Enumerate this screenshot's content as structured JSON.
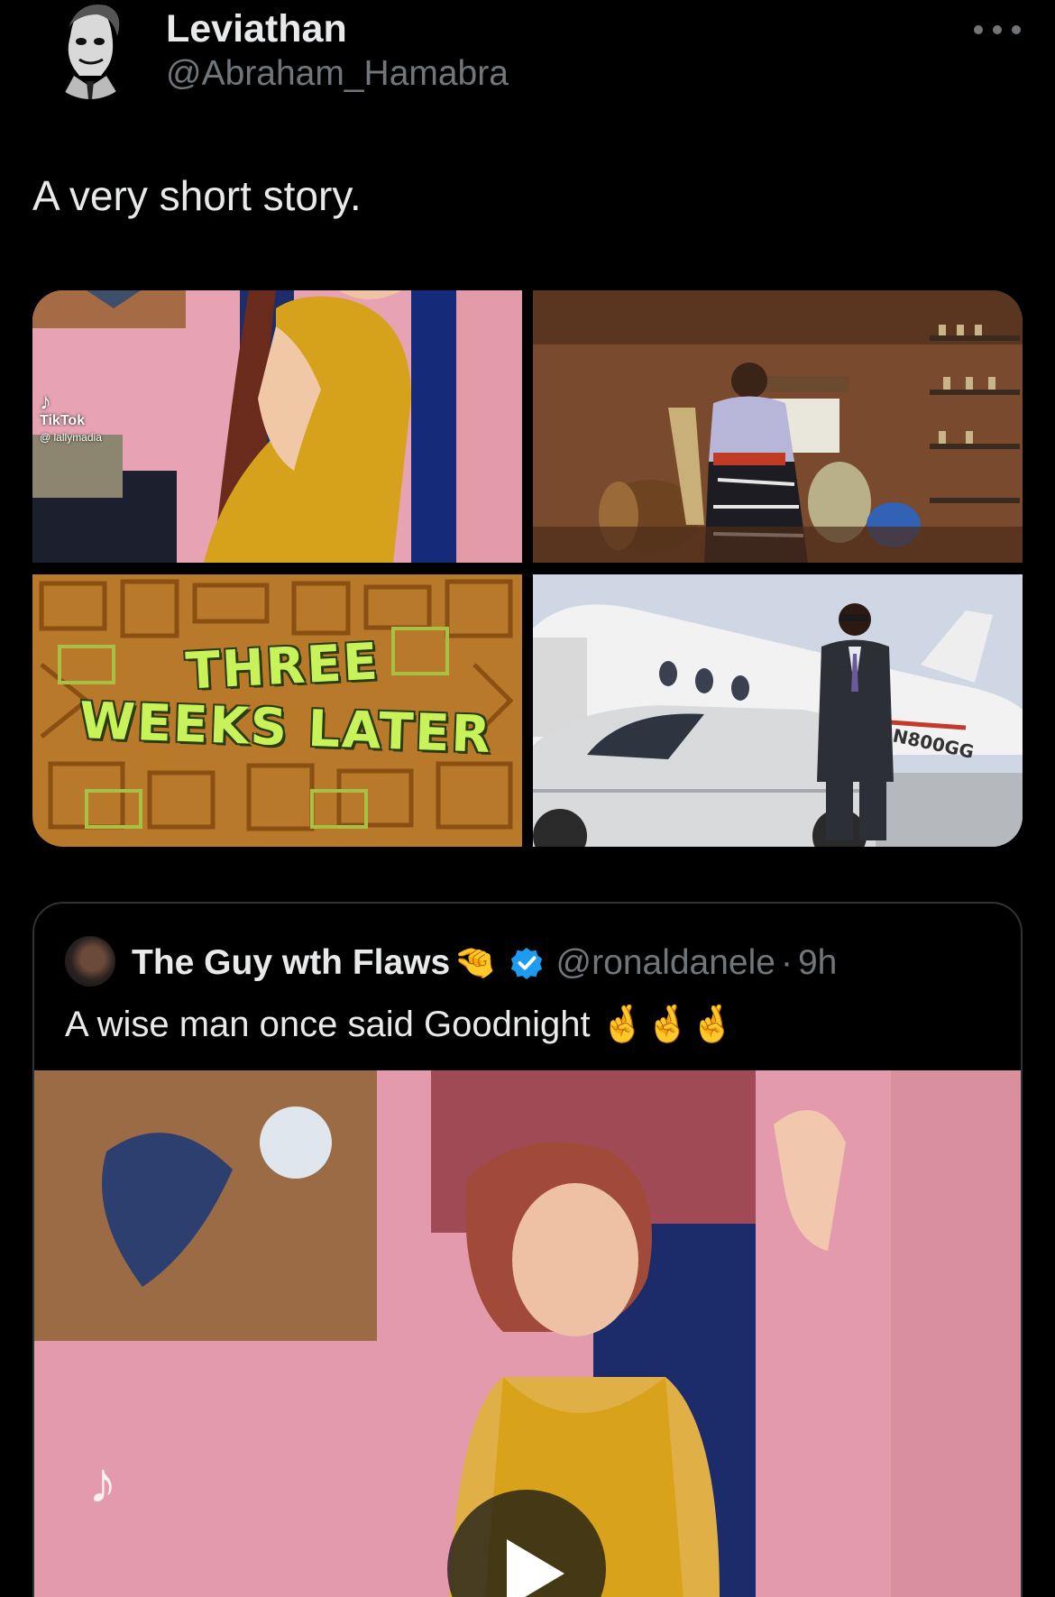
{
  "tweet": {
    "author_name": "Leviathan",
    "author_handle": "@Abraham_Hamabra",
    "text": "A very short story.",
    "media": {
      "tile_1": {
        "icon": "tiktok-icon",
        "watermark": "TikTok",
        "watermark_user": "@ lallymadia"
      },
      "tile_2": {
        "desc_icon": "photo"
      },
      "tile_3": {
        "line_1": "THREE",
        "line_2": "WEEKS LATER"
      },
      "tile_4": {
        "plane_reg": "N800GG"
      }
    }
  },
  "quote": {
    "author_name": "The Guy wth Flaws",
    "name_emoji": "🤏",
    "verified_icon": "verified-badge-icon",
    "author_handle": "@ronaldanele",
    "separator": "·",
    "time": "9h",
    "text": "A wise man once said Goodnight 🤞🤞🤞",
    "video": {
      "icon": "play-icon",
      "watermark_icon": "tiktok-icon"
    }
  },
  "colors": {
    "background": "#000000",
    "text": "#e7e9ea",
    "muted": "#71767b",
    "verified": "#1d9bf0",
    "border": "#2f3336"
  }
}
